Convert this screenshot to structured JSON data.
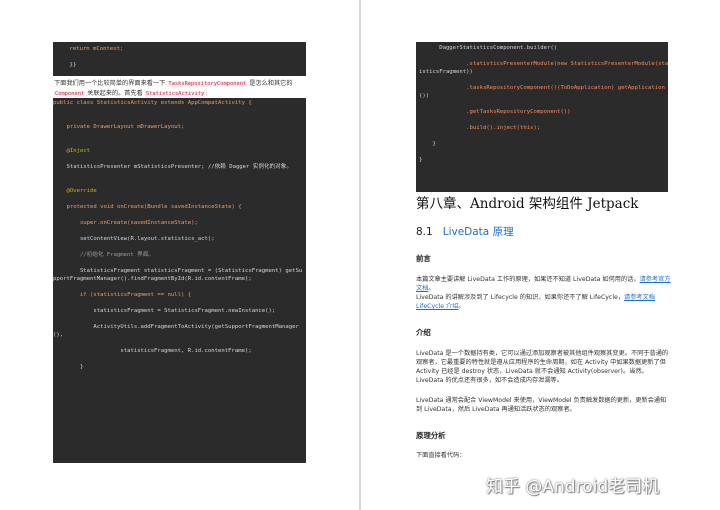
{
  "left": {
    "top_code": [
      "    return mContext;",
      "",
      "    }}"
    ],
    "intro": {
      "part1": "下面我们用一个比较简单的界面来看一下 ",
      "code1": "TasksRepositoryComponent",
      "part2": " 是怎么和其它的 ",
      "code2": "Component",
      "part3": " 关联起来的。首先看 ",
      "code3": "StatisticsActivity",
      "part4": ":"
    },
    "code_lines": [
      "public class StatisticsActivity extends AppCompatActivity {",
      "",
      "",
      "    private DrawerLayout mDrawerLayout;",
      "",
      "",
      "    @Inject",
      "",
      "    StatisticsPresenter mStatisticsPresenter; //依赖 Dagger 实例化的对象。",
      "",
      "",
      "    @Override",
      "",
      "    protected void onCreate(Bundle savedInstanceState) {",
      "",
      "        super.onCreate(savedInstanceState);",
      "",
      "        setContentView(R.layout.statistics_act);",
      "",
      "        //初始化 Fragment 界面。",
      "",
      "        StatisticsFragment statisticsFragment = (StatisticsFragment) getSu",
      "pportFragmentManager().findFragmentById(R.id.contentFrame);",
      "",
      "        if (statisticsFragment == null) {",
      "",
      "            statisticsFragment = StatisticsFragment.newInstance();",
      "",
      "            ActivityUtils.addFragmentToActivity(getSupportFragmentManager",
      "(),",
      "",
      "                    statisticsFragment, R.id.contentFrame);",
      "",
      "        }"
    ]
  },
  "right": {
    "code_lines": [
      "      DaggerStatisticsComponent.builder()",
      "",
      "              .statisticsPresenterModule(new StatisticsPresenterModule(stat",
      "isticsFragment))",
      "",
      "              .tasksRepositoryComponent(((ToDoApplication) getApplication",
      "())",
      "",
      "              .getTasksRepositoryComponent())",
      "",
      "              .build().inject(this);",
      "",
      "    }",
      "",
      "}"
    ],
    "chapter_title": "第八章、Android 架构组件 Jetpack",
    "section_number": "8.1",
    "section_title": "LiveData 原理",
    "preface": {
      "heading": "前言",
      "line1_text": "本篇文章主要讲解 LiveData 工作的原理，如果还不知道 LiveData 如何用的话，",
      "line1_link": "请参考官方文档",
      "line1_end": "。",
      "line2_text": "LiveData 的讲解涉及到了 Lifecycle 的知识，如果你还不了解 LifeCycle，",
      "line2_link": "请参考文档 LifeCycle 介绍",
      "line2_end": "。"
    },
    "intro": {
      "heading": "介绍",
      "para1": "LiveData 是一个数据持有类，它可以通过添加观察者被其他组件观察其变更。不同于普通的观察者，它最重要的特性就是遵从应用程序的生命周期，如在 Activity 中如果数据更新了但 Activity 已经是 destroy 状态，LiveData 就不会通知 Activity(observer)。当然。LiveData 的优点还有很多，如不会造成内存泄漏等。",
      "para2": "LiveData 通常会配合 ViewModel 来使用，ViewModel 负责触发数据的更新，更新会通知到 LiveData，然后 LiveData 再通知活跃状态的观察者。"
    },
    "analysis": {
      "heading": "原理分析",
      "para": "下面直接看代码："
    }
  },
  "watermark": "知乎 @Android老司机"
}
